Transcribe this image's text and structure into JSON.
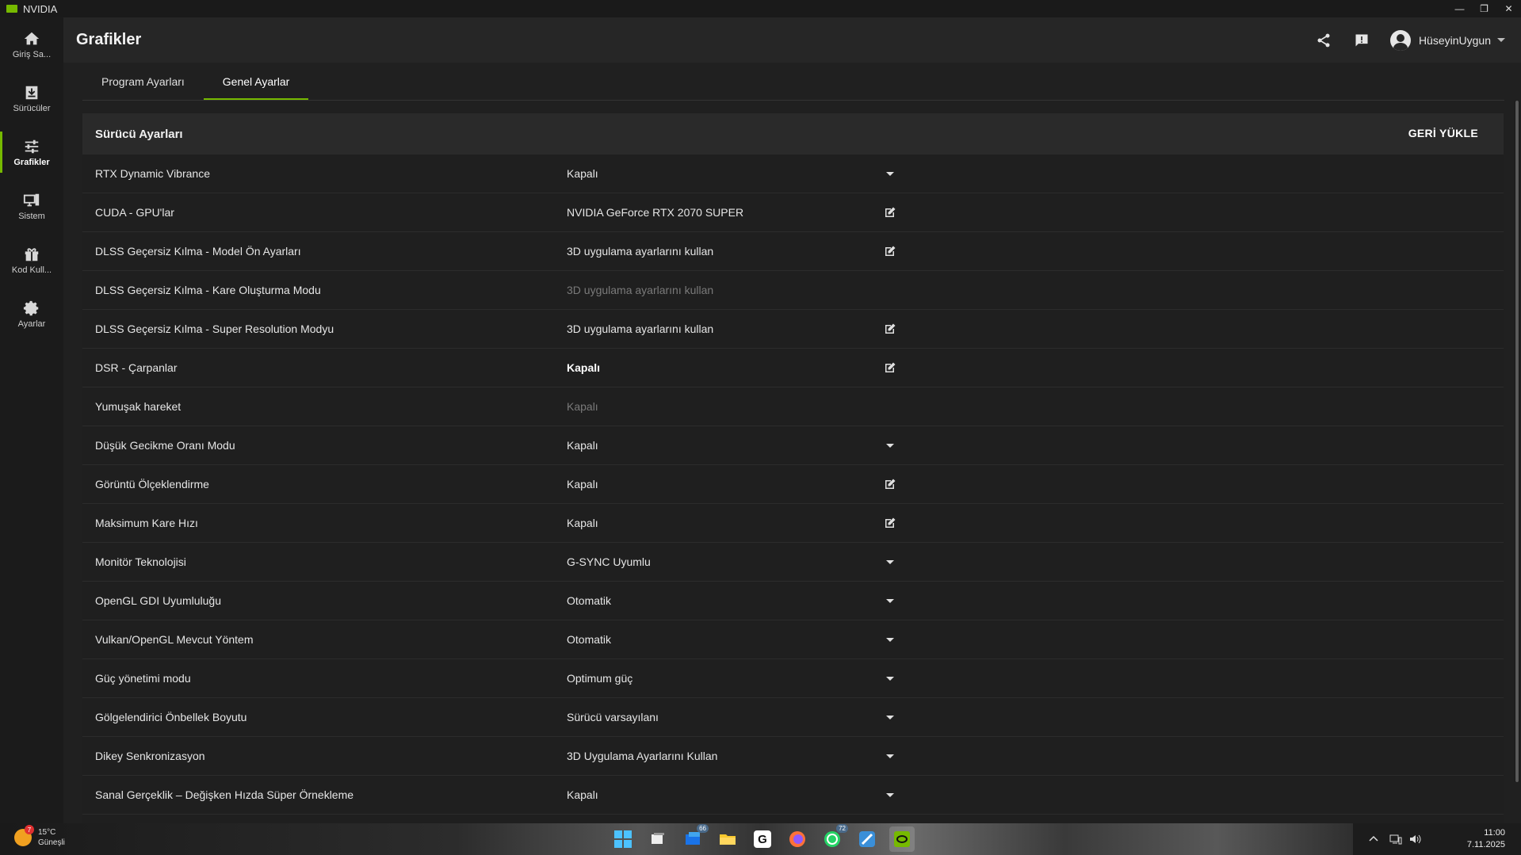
{
  "window": {
    "app_title": "NVIDIA",
    "min": "—",
    "restore": "❐",
    "close": "✕"
  },
  "sidebar": {
    "items": [
      {
        "label": "Giriş Sa...",
        "icon": "home-icon"
      },
      {
        "label": "Sürücüler",
        "icon": "download-icon"
      },
      {
        "label": "Grafikler",
        "icon": "sliders-icon",
        "active": true
      },
      {
        "label": "Sistem",
        "icon": "monitor-icon"
      },
      {
        "label": "Kod Kull...",
        "icon": "gift-icon"
      },
      {
        "label": "Ayarlar",
        "icon": "gear-icon"
      }
    ]
  },
  "header": {
    "title": "Grafikler",
    "username": "HüseyinUygun"
  },
  "tabs": [
    {
      "label": "Program Ayarları"
    },
    {
      "label": "Genel Ayarlar",
      "active": true
    }
  ],
  "panel": {
    "title": "Sürücü Ayarları",
    "reset_label": "GERİ YÜKLE",
    "rows": [
      {
        "name": "RTX Dynamic Vibrance",
        "value": "Kapalı",
        "control": "dropdown"
      },
      {
        "name": "CUDA - GPU'lar",
        "value": "NVIDIA GeForce RTX 2070 SUPER",
        "control": "edit"
      },
      {
        "name": "DLSS Geçersiz Kılma - Model Ön Ayarları",
        "value": "3D uygulama ayarlarını kullan",
        "control": "edit"
      },
      {
        "name": "DLSS Geçersiz Kılma - Kare Oluşturma Modu",
        "value": "3D uygulama ayarlarını kullan",
        "control": "none",
        "muted": true
      },
      {
        "name": "DLSS Geçersiz Kılma - Super Resolution Modyu",
        "value": "3D uygulama ayarlarını kullan",
        "control": "edit"
      },
      {
        "name": "DSR - Çarpanlar",
        "value": "Kapalı",
        "control": "edit",
        "bold": true
      },
      {
        "name": "Yumuşak hareket",
        "value": "Kapalı",
        "control": "none",
        "muted": true
      },
      {
        "name": "Düşük Gecikme Oranı Modu",
        "value": "Kapalı",
        "control": "dropdown"
      },
      {
        "name": "Görüntü Ölçeklendirme",
        "value": "Kapalı",
        "control": "edit"
      },
      {
        "name": "Maksimum Kare Hızı",
        "value": "Kapalı",
        "control": "edit"
      },
      {
        "name": "Monitör Teknolojisi",
        "value": "G-SYNC Uyumlu",
        "control": "dropdown"
      },
      {
        "name": "OpenGL GDI Uyumluluğu",
        "value": "Otomatik",
        "control": "dropdown"
      },
      {
        "name": "Vulkan/OpenGL Mevcut Yöntem",
        "value": "Otomatik",
        "control": "dropdown"
      },
      {
        "name": "Güç yönetimi modu",
        "value": "Optimum güç",
        "control": "dropdown"
      },
      {
        "name": "Gölgelendirici Önbellek Boyutu",
        "value": "Sürücü varsayılanı",
        "control": "dropdown"
      },
      {
        "name": "Dikey Senkronizasyon",
        "value": "3D Uygulama Ayarlarını Kullan",
        "control": "dropdown"
      },
      {
        "name": "Sanal Gerçeklik – Değişken Hızda Süper Örnekleme",
        "value": "Kapalı",
        "control": "dropdown"
      }
    ]
  },
  "taskbar": {
    "weather_badge": "7",
    "temperature": "15°C",
    "condition": "Güneşli",
    "apps": [
      {
        "name": "windows-start-icon",
        "badge": ""
      },
      {
        "name": "task-view-icon",
        "badge": ""
      },
      {
        "name": "outlook-icon",
        "badge": "66"
      },
      {
        "name": "file-explorer-icon",
        "badge": ""
      },
      {
        "name": "g-app-icon",
        "badge": "",
        "glyph": "G"
      },
      {
        "name": "firefox-icon",
        "badge": ""
      },
      {
        "name": "whatsapp-icon",
        "badge": "72"
      },
      {
        "name": "app-icon",
        "badge": ""
      },
      {
        "name": "nvidia-app-icon",
        "badge": "",
        "active": true
      }
    ],
    "time": "11:00",
    "date": "7.11.2025"
  },
  "colors": {
    "accent": "#76b900",
    "background": "#202020"
  }
}
